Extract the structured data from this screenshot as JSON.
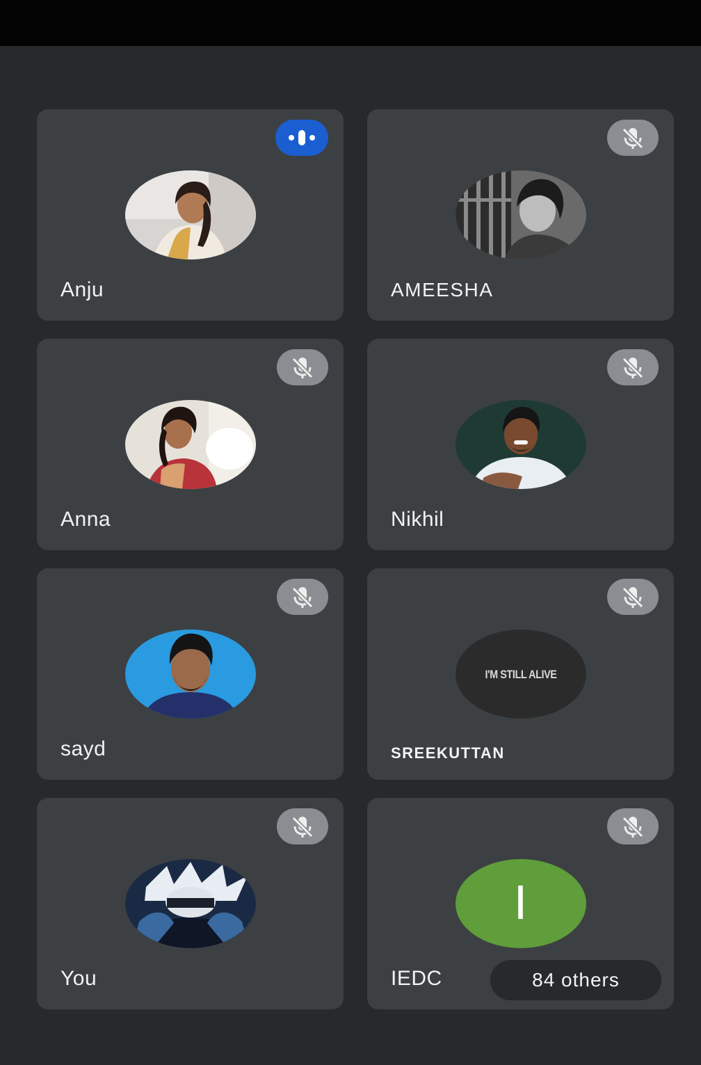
{
  "participants": [
    {
      "name": "Anju",
      "mic": "speaking"
    },
    {
      "name": "AMEESHA",
      "mic": "muted"
    },
    {
      "name": "Anna",
      "mic": "muted"
    },
    {
      "name": "Nikhil",
      "mic": "muted"
    },
    {
      "name": "sayd",
      "mic": "muted"
    },
    {
      "name": "SREEKUTTAN",
      "mic": "muted",
      "avatar_text": "I'M STILL ALIVE"
    },
    {
      "name": "You",
      "mic": "muted"
    },
    {
      "name": "IEDC",
      "mic": "muted",
      "avatar_initial": "I",
      "avatar_color": "#5f9e3a",
      "others_label": "84 others"
    }
  ],
  "colors": {
    "background": "#28292d",
    "tile": "#3c4043",
    "speaking_badge": "#1a5ed1",
    "muted_badge": "#8a8d91"
  },
  "icons": {
    "muted": "mic-off-icon",
    "speaking": "audio-level-icon"
  }
}
